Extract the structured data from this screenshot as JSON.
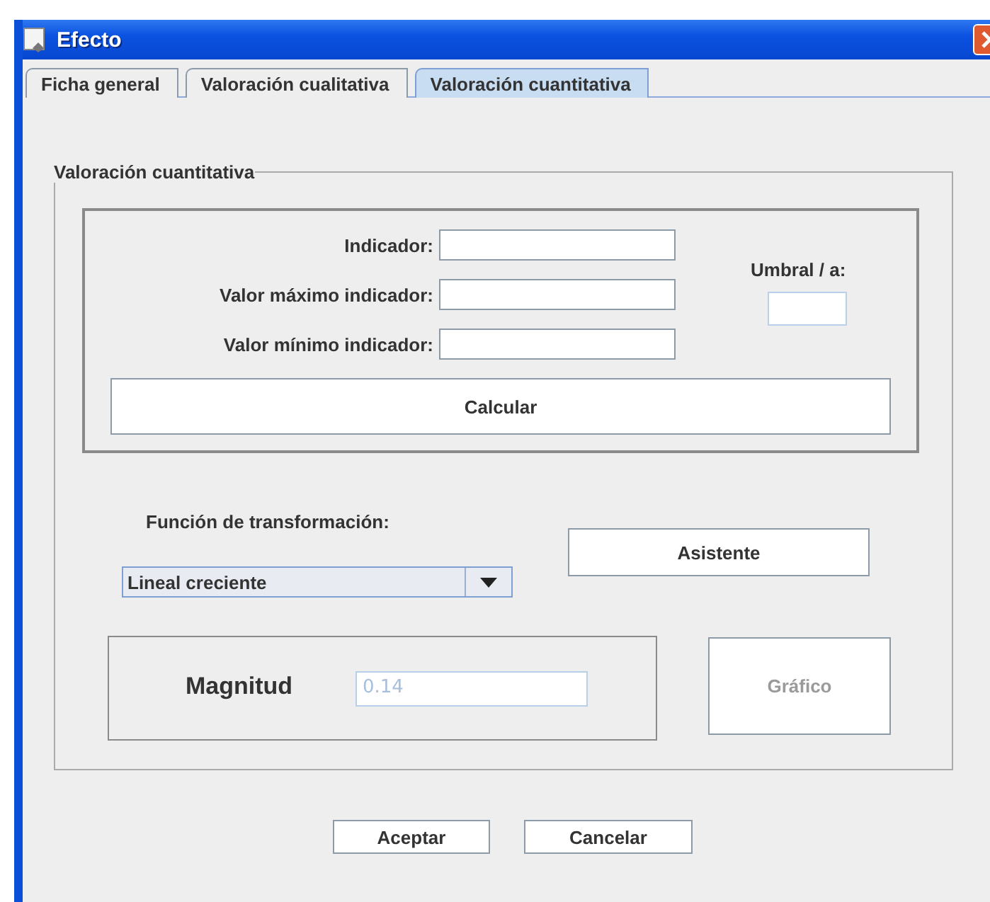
{
  "window": {
    "title": "Efecto"
  },
  "tabs": [
    {
      "label": "Ficha general",
      "selected": false
    },
    {
      "label": "Valoración cualitativa",
      "selected": false
    },
    {
      "label": "Valoración cuantitativa",
      "selected": true
    }
  ],
  "group": {
    "title": "Valoración cuantitativa",
    "indicator_fields": [
      {
        "label": "Indicador:"
      },
      {
        "label": "Valor máximo indicador:"
      },
      {
        "label": "Valor mínimo indicador:"
      }
    ],
    "threshold": {
      "label": "Umbral / a:"
    },
    "calculate_button": "Calcular",
    "transform": {
      "label": "Función de transformación:",
      "value": "Lineal creciente"
    },
    "assistant_button": "Asistente",
    "magnitude": {
      "label": "Magnitud",
      "value": "0.14",
      "disabled": true
    },
    "chart_button": {
      "label": "Gráfico",
      "disabled": true
    }
  },
  "buttons": [
    "Aceptar",
    "Cancelar"
  ]
}
